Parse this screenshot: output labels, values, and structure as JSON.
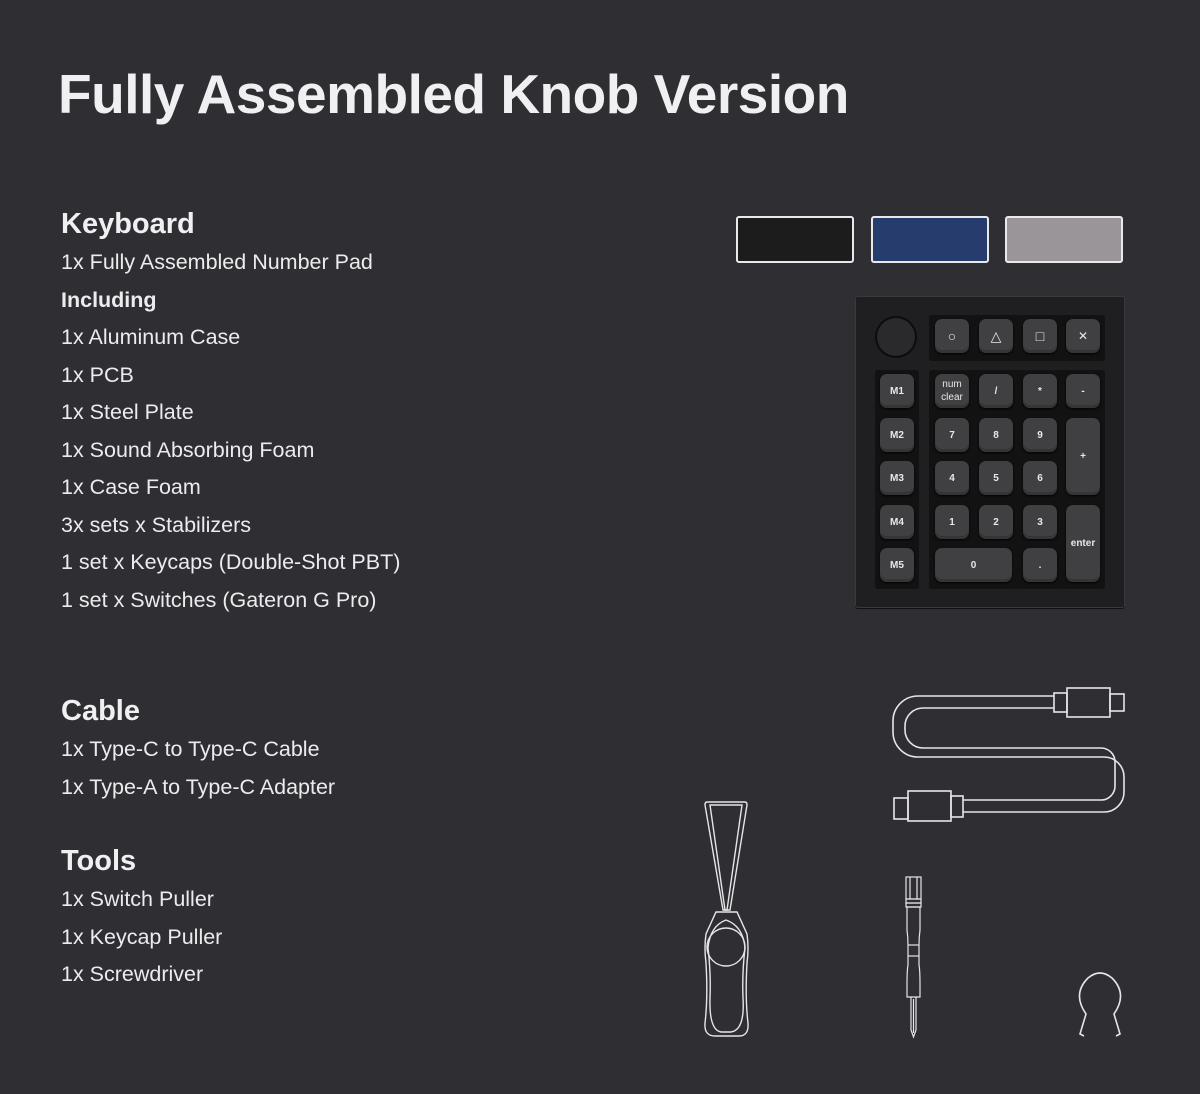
{
  "title": "Fully Assembled Knob Version",
  "sections": {
    "keyboard": {
      "heading": "Keyboard",
      "items": [
        "1x Fully Assembled Number Pad",
        "Including",
        "1x Aluminum Case",
        "1x PCB",
        "1x Steel Plate",
        "1x Sound Absorbing Foam",
        "1x Case Foam",
        "3x sets x Stabilizers",
        "1 set x Keycaps (Double-Shot PBT)",
        "1 set x Switches (Gateron G Pro)"
      ]
    },
    "cable": {
      "heading": "Cable",
      "items": [
        "1x Type-C to Type-C Cable",
        "1x Type-A to Type-C Adapter"
      ]
    },
    "tools": {
      "heading": "Tools",
      "items": [
        "1x Switch Puller",
        "1x Keycap Puller",
        "1x Screwdriver"
      ]
    }
  },
  "color_swatches": [
    {
      "name": "black",
      "color": "#1c1c1d"
    },
    {
      "name": "navy-blue",
      "color": "#263c6c"
    },
    {
      "name": "gray",
      "color": "#9a9599"
    }
  ],
  "keyboard_image": {
    "knob": "rotary-knob",
    "keys": {
      "circle": "○",
      "triangle": "△",
      "square": "□",
      "cross": "✕",
      "m1": "M1",
      "m2": "M2",
      "m3": "M3",
      "m4": "M4",
      "m5": "M5",
      "num_clear_1": "num",
      "num_clear_2": "clear",
      "slash": "/",
      "asterisk": "*",
      "minus": "-",
      "plus": "+",
      "enter": "enter",
      "k7": "7",
      "k8": "8",
      "k9": "9",
      "k4": "4",
      "k5": "5",
      "k6": "6",
      "k1": "1",
      "k2": "2",
      "k3": "3",
      "k0": "0",
      "dot": "."
    }
  },
  "illustrations": [
    "usb-c-cable",
    "switch-puller",
    "screwdriver",
    "keycap-puller"
  ]
}
